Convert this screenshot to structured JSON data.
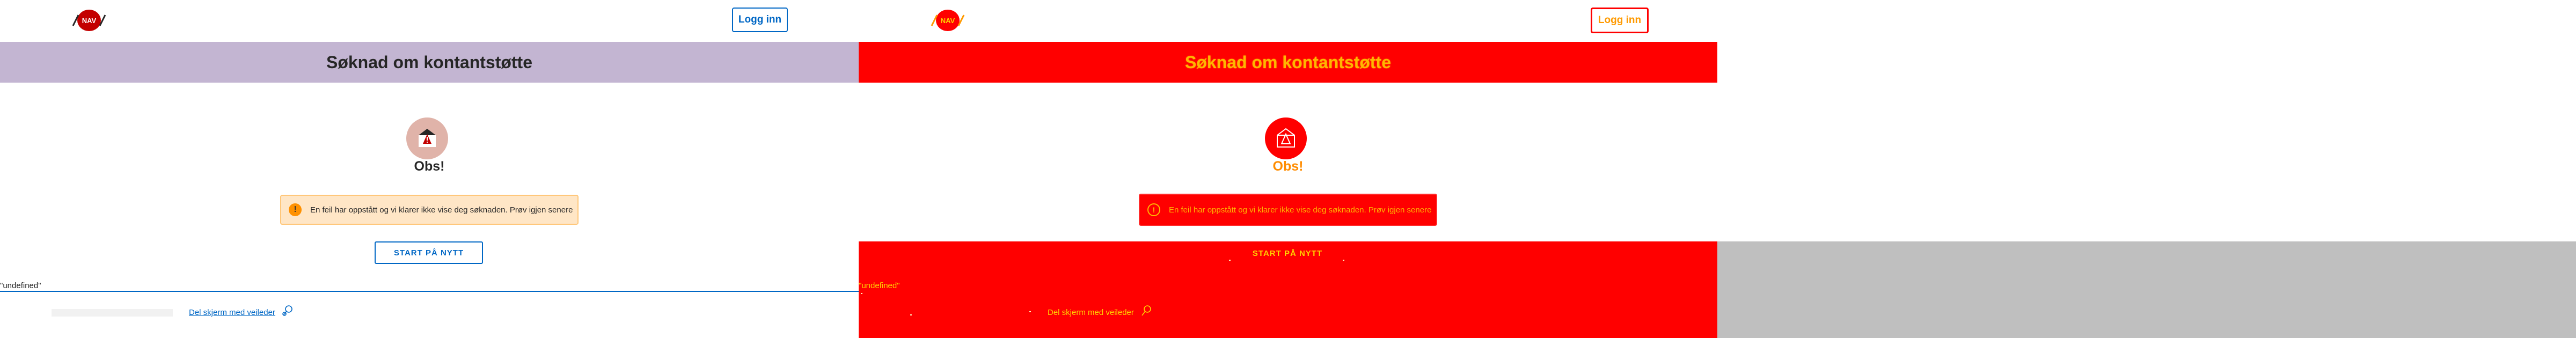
{
  "header": {
    "logo_text": "NAV",
    "login_label": "Logg inn"
  },
  "page": {
    "title": "Søknad om kontantstøtte",
    "heading": "Obs!",
    "alert_icon": "!",
    "alert_message": "En feil har oppstått og vi klarer ikke vise deg søknaden. Prøv igjen senere",
    "restart_label": "START PÅ NYTT",
    "undefined_text": "\"undefined\"",
    "share_link": "Del skjerm med veileder"
  },
  "icons": {
    "logo": "nav-logo-icon",
    "envelope": "envelope-warning-icon",
    "alert": "warning-circle-icon",
    "share": "screen-share-icon"
  },
  "colors": {
    "banner": "#c3b5d2",
    "link": "#0067c5",
    "alert_bg": "#ffe6c6",
    "alert_border": "#ffc77a",
    "logo_red": "#c30000",
    "diff_red": "#ff0000",
    "diff_text": "#ffb700",
    "blank_grey": "#bfbfbf"
  }
}
